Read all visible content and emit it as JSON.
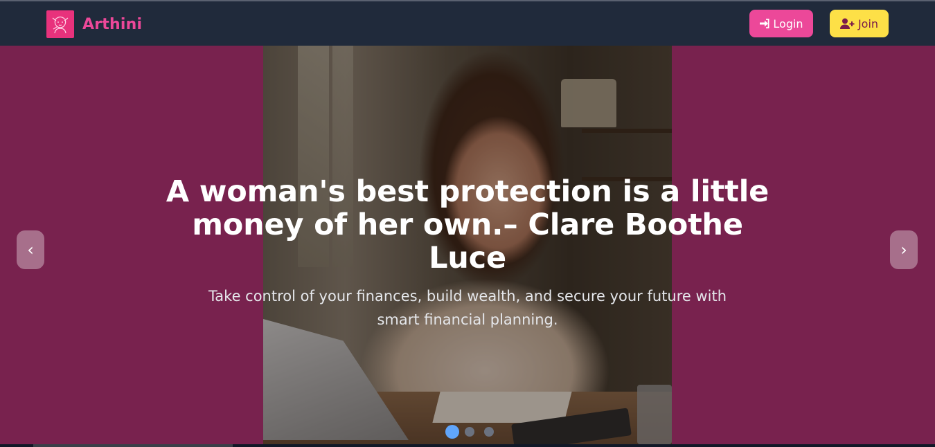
{
  "header": {
    "brand_name": "Arthini",
    "logo_icon": "woman-portrait-icon",
    "login_label": "Login",
    "login_icon": "sign-in-icon",
    "join_label": "Join",
    "join_icon": "user-plus-icon"
  },
  "hero": {
    "headline": "A woman's best protection is a little money of her own.– Clare Boothe Luce",
    "subtitle": "Take control of your finances, build wealth, and secure your future with smart financial planning.",
    "prev_label": "‹",
    "next_label": "›",
    "slides_total": 3,
    "active_slide": 1
  },
  "colors": {
    "navbar": "#202a3b",
    "hero_background": "#78224e",
    "brand_pink": "#ec4899",
    "join_yellow": "#fde047",
    "active_dot": "#60a5fa"
  }
}
